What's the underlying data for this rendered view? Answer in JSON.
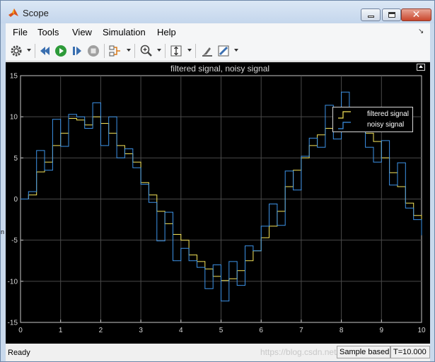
{
  "window": {
    "title": "Scope",
    "close_glyph": "✕"
  },
  "menu": [
    "File",
    "Tools",
    "View",
    "Simulation",
    "Help"
  ],
  "menu_dock_glyph": "↘",
  "toolbar": {
    "icons": [
      "settings-icon",
      "step-back-icon",
      "run-icon",
      "step-forward-icon",
      "stop-icon",
      "signal-selector-icon",
      "zoom-in-icon",
      "scale-axes-icon",
      "highlight-icon",
      "style-icon"
    ]
  },
  "left_edge_label": "n",
  "chart_data": {
    "type": "line",
    "title": "filtered signal, noisy signal",
    "xlabel": "",
    "ylabel": "",
    "xlim": [
      0,
      10
    ],
    "ylim": [
      -15,
      15
    ],
    "x_ticks": [
      "0",
      "1",
      "2",
      "3",
      "4",
      "5",
      "6",
      "7",
      "8",
      "9",
      "10"
    ],
    "y_ticks": [
      "15",
      "10",
      "5",
      "0",
      "-5",
      "-10",
      "-15"
    ],
    "grid": true,
    "legend_position": "top-right",
    "step": true,
    "x": [
      0,
      0.2,
      0.4,
      0.6,
      0.8,
      1.0,
      1.2,
      1.4,
      1.6,
      1.8,
      2.0,
      2.2,
      2.4,
      2.6,
      2.8,
      3.0,
      3.2,
      3.4,
      3.6,
      3.8,
      4.0,
      4.2,
      4.4,
      4.6,
      4.8,
      5.0,
      5.2,
      5.4,
      5.6,
      5.8,
      6.0,
      6.2,
      6.4,
      6.6,
      6.8,
      7.0,
      7.2,
      7.4,
      7.6,
      7.8,
      8.0,
      8.2,
      8.4,
      8.6,
      8.8,
      9.0,
      9.2,
      9.4,
      9.6,
      9.8,
      10.0
    ],
    "series": [
      {
        "name": "filtered signal",
        "color": "#f5e45a",
        "values": [
          0.0,
          0.5,
          3.3,
          4.5,
          6.5,
          8.0,
          9.8,
          9.6,
          9.0,
          10.0,
          9.2,
          8.0,
          6.5,
          5.5,
          4.5,
          2.0,
          0.5,
          -1.5,
          -3.0,
          -4.3,
          -5.0,
          -6.8,
          -7.6,
          -8.5,
          -9.4,
          -9.9,
          -9.7,
          -8.7,
          -7.5,
          -6.3,
          -4.7,
          -3.3,
          -1.5,
          1.5,
          3.5,
          5.0,
          6.5,
          7.8,
          8.6,
          9.6,
          10.5,
          9.6,
          9.0,
          8.0,
          7.0,
          5.0,
          3.2,
          1.5,
          -0.5,
          -2.0,
          -3.3
        ]
      },
      {
        "name": "noisy signal",
        "color": "#3d93e8",
        "values": [
          0.0,
          0.9,
          5.9,
          3.5,
          9.7,
          6.4,
          10.3,
          10.0,
          8.6,
          11.7,
          6.5,
          10.0,
          5.0,
          6.1,
          3.8,
          1.8,
          -0.4,
          -5.1,
          -1.6,
          -7.5,
          -6.0,
          -7.5,
          -8.3,
          -10.9,
          -8.0,
          -12.4,
          -7.6,
          -10.5,
          -5.7,
          -6.3,
          -3.3,
          -0.6,
          -3.2,
          3.4,
          1.1,
          5.2,
          7.4,
          6.3,
          11.4,
          7.3,
          13.0,
          9.1,
          8.8,
          6.3,
          4.5,
          7.1,
          1.7,
          4.4,
          -1.1,
          -2.5,
          -4.4
        ]
      }
    ]
  },
  "status": {
    "ready": "Ready",
    "mode": "Sample based",
    "time": "T=10.000",
    "watermark": "https://blog.csdn.net/..."
  }
}
